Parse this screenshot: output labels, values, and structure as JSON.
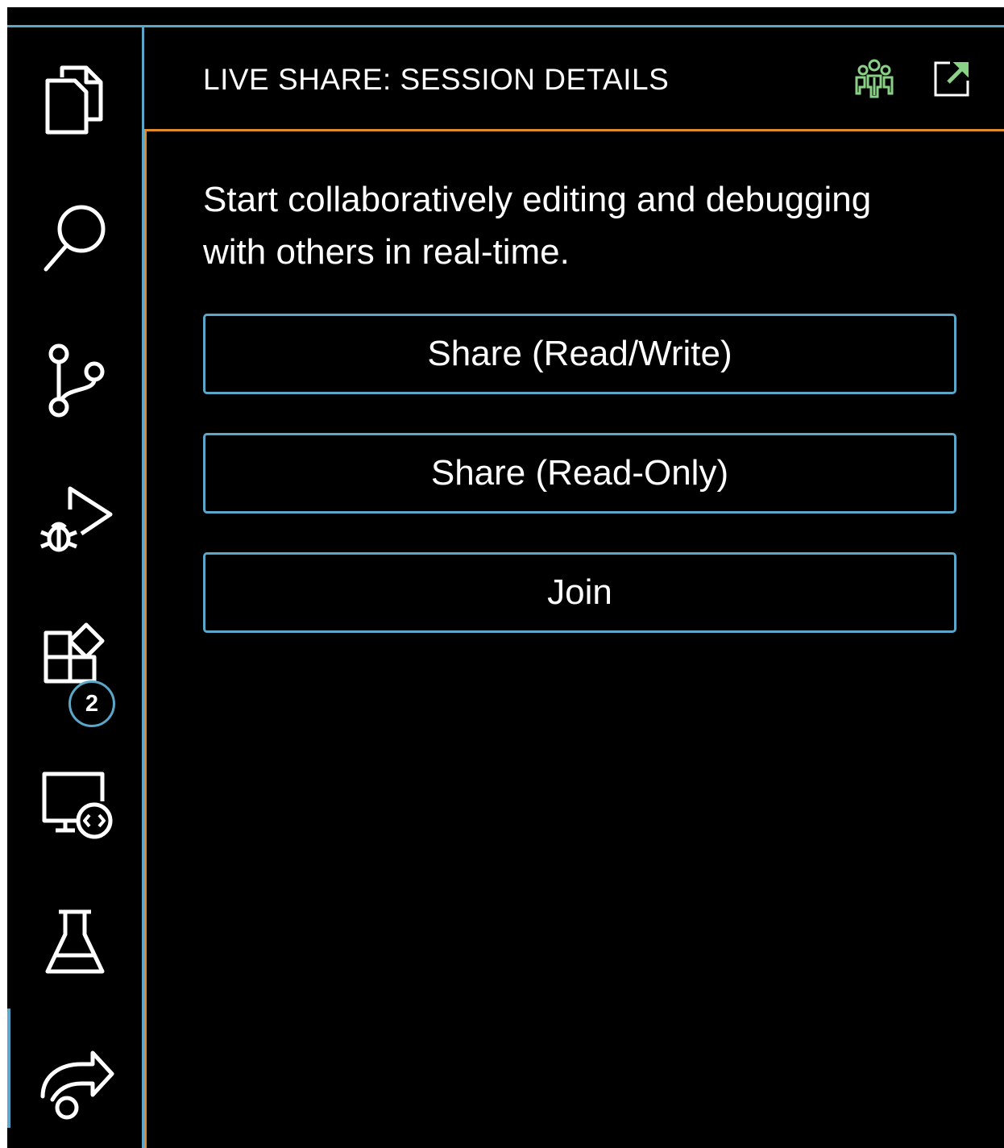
{
  "activity_bar": {
    "items": [
      {
        "icon": "files-icon"
      },
      {
        "icon": "search-icon"
      },
      {
        "icon": "source-control-icon"
      },
      {
        "icon": "run-debug-icon"
      },
      {
        "icon": "extensions-icon",
        "badge": "2"
      },
      {
        "icon": "remote-explorer-icon"
      },
      {
        "icon": "testing-flask-icon"
      },
      {
        "icon": "live-share-icon",
        "active": true
      }
    ]
  },
  "panel": {
    "title": "LIVE SHARE: SESSION DETAILS",
    "header_actions": [
      {
        "icon": "live-share-people-icon",
        "color": "#89d185"
      },
      {
        "icon": "open-external-icon",
        "color": "#89d185"
      }
    ],
    "intro": "Start collaboratively editing and debugging with others in real-time.",
    "buttons": {
      "share_read_write": "Share (Read/Write)",
      "share_read_only": "Share (Read-Only)",
      "join": "Join"
    }
  },
  "colors": {
    "background": "#000000",
    "contrast_border": "#5aa7c9",
    "focus_border": "#e08a2c",
    "text": "#ffffff",
    "accent_green": "#89d185"
  }
}
